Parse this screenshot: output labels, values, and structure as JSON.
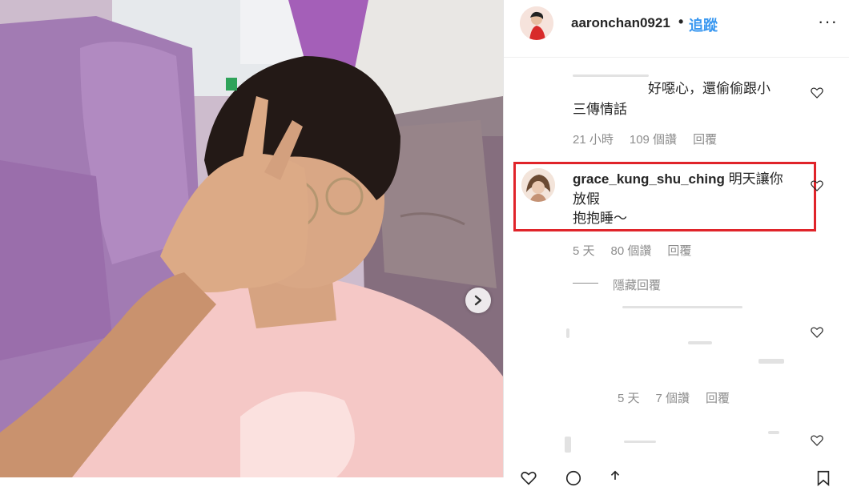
{
  "header": {
    "username": "aaronchan0921",
    "separator": "•",
    "follow_label": "追蹤",
    "more_label": "···"
  },
  "comments": [
    {
      "text_line1": "好噁心，還偷偷跟小",
      "text_line2": "三傳情話",
      "time": "21 小時",
      "likes": "109 個讚",
      "reply": "回覆"
    },
    {
      "username": "grace_kung_shu_ching",
      "text_line1": "明天讓你",
      "text_line2": "放假",
      "text_line3": "抱抱睡～",
      "time": "5 天",
      "likes": "80 個讚",
      "reply": "回覆",
      "hide_replies": "隱藏回覆"
    },
    {
      "time": "5 天",
      "likes": "7 個讚",
      "reply": "回覆"
    }
  ],
  "colors": {
    "follow": "#3897f0",
    "highlight_border": "#e0242a",
    "meta": "#8e8e8e"
  },
  "icons": [
    "next-arrow-icon",
    "heart-icon",
    "comment-icon",
    "share-icon",
    "bookmark-icon",
    "more-icon"
  ]
}
